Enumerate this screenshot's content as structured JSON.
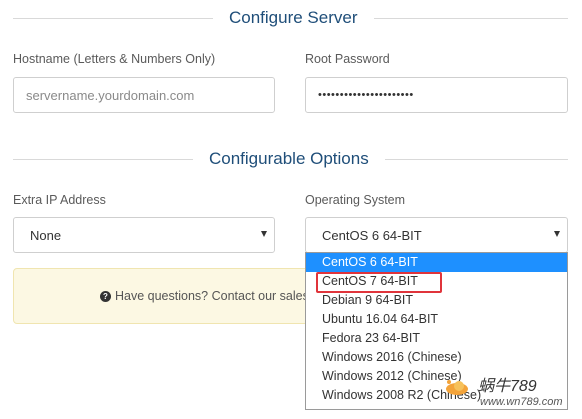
{
  "sections": {
    "server_title": "Configure Server",
    "options_title": "Configurable Options"
  },
  "fields": {
    "hostname_label": "Hostname (Letters & Numbers Only)",
    "hostname_placeholder": "servername.yourdomain.com",
    "root_password_label": "Root Password",
    "root_password_value": "••••••••••••••••••••••",
    "extra_ip_label": "Extra IP Address",
    "extra_ip_value": "None",
    "os_label": "Operating System",
    "os_value": "CentOS 6 64-BIT"
  },
  "os_options": [
    "CentOS 6 64-BIT",
    "CentOS 7 64-BIT",
    "Debian 9 64-BIT",
    "Ubuntu 16.04 64-BIT",
    "Fedora 23 64-BIT",
    "Windows 2016 (Chinese)",
    "Windows 2012 (Chinese)",
    "Windows 2008 R2 (Chinese)"
  ],
  "os_selected_index": 0,
  "os_highlighted_index": 1,
  "notice": {
    "text": "Have questions? Contact our sales"
  },
  "watermark": {
    "brand": "蜗牛789",
    "url": "www.wn789.com"
  },
  "colors": {
    "heading": "#1f4e79",
    "selected_bg": "#1e90ff",
    "highlight_border": "#e0343b",
    "notice_bg": "#fcf8e3"
  },
  "icons": {
    "notice": "question-circle-icon",
    "select_caret": "caret-down-icon"
  }
}
